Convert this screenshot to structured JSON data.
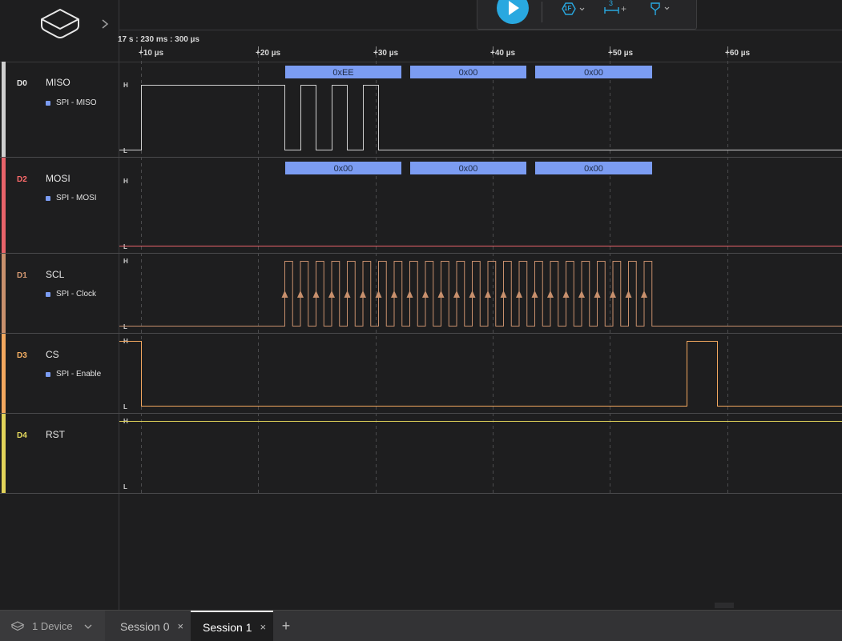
{
  "header": {
    "cursor_time": "17 s : 230 ms : 300 µs",
    "ticks": [
      "+10 µs",
      "+20 µs",
      "+30 µs",
      "+40 µs",
      "+50 µs",
      "+60 µs"
    ]
  },
  "channels": [
    {
      "id": "D0",
      "name": "MISO",
      "analyzer": "SPI - MISO",
      "color": "#cfcfcf",
      "id_color": "#e6e6e6",
      "high": "H",
      "low": "L"
    },
    {
      "id": "D2",
      "name": "MOSI",
      "analyzer": "SPI - MOSI",
      "color": "#e8636a",
      "id_color": "#ff6b6b",
      "high": "H",
      "low": "L"
    },
    {
      "id": "D1",
      "name": "SCL",
      "analyzer": "SPI - Clock",
      "color": "#c8906d",
      "id_color": "#d69a73",
      "high": "H",
      "low": "L"
    },
    {
      "id": "D3",
      "name": "CS",
      "analyzer": "SPI - Enable",
      "color": "#f3a85f",
      "id_color": "#f6b063",
      "high": "H",
      "low": "L"
    },
    {
      "id": "D4",
      "name": "RST",
      "analyzer": "",
      "color": "#e2d45a",
      "id_color": "#e5d95e",
      "high": "H",
      "low": "L"
    }
  ],
  "decoded": {
    "miso": [
      "0xEE",
      "0x00",
      "0x00"
    ],
    "mosi": [
      "0x00",
      "0x00",
      "0x00"
    ],
    "bubble_color": "#7b9cf2"
  },
  "toolbar": {
    "play_icon": "play-icon",
    "trigger_icon": "trigger-icon",
    "trigger_label": "1F",
    "measure_icon": "measure-icon",
    "measure_label": "3",
    "measure_add": "+",
    "marker_icon": "marker-icon",
    "accent": "#29a8e0"
  },
  "status": {
    "device_icon": "device-icon",
    "device_label": "1 Device",
    "tabs": [
      {
        "label": "Session 0",
        "close": "×",
        "active": false
      },
      {
        "label": "Session 1",
        "close": "×",
        "active": true
      }
    ],
    "add_label": "+"
  }
}
